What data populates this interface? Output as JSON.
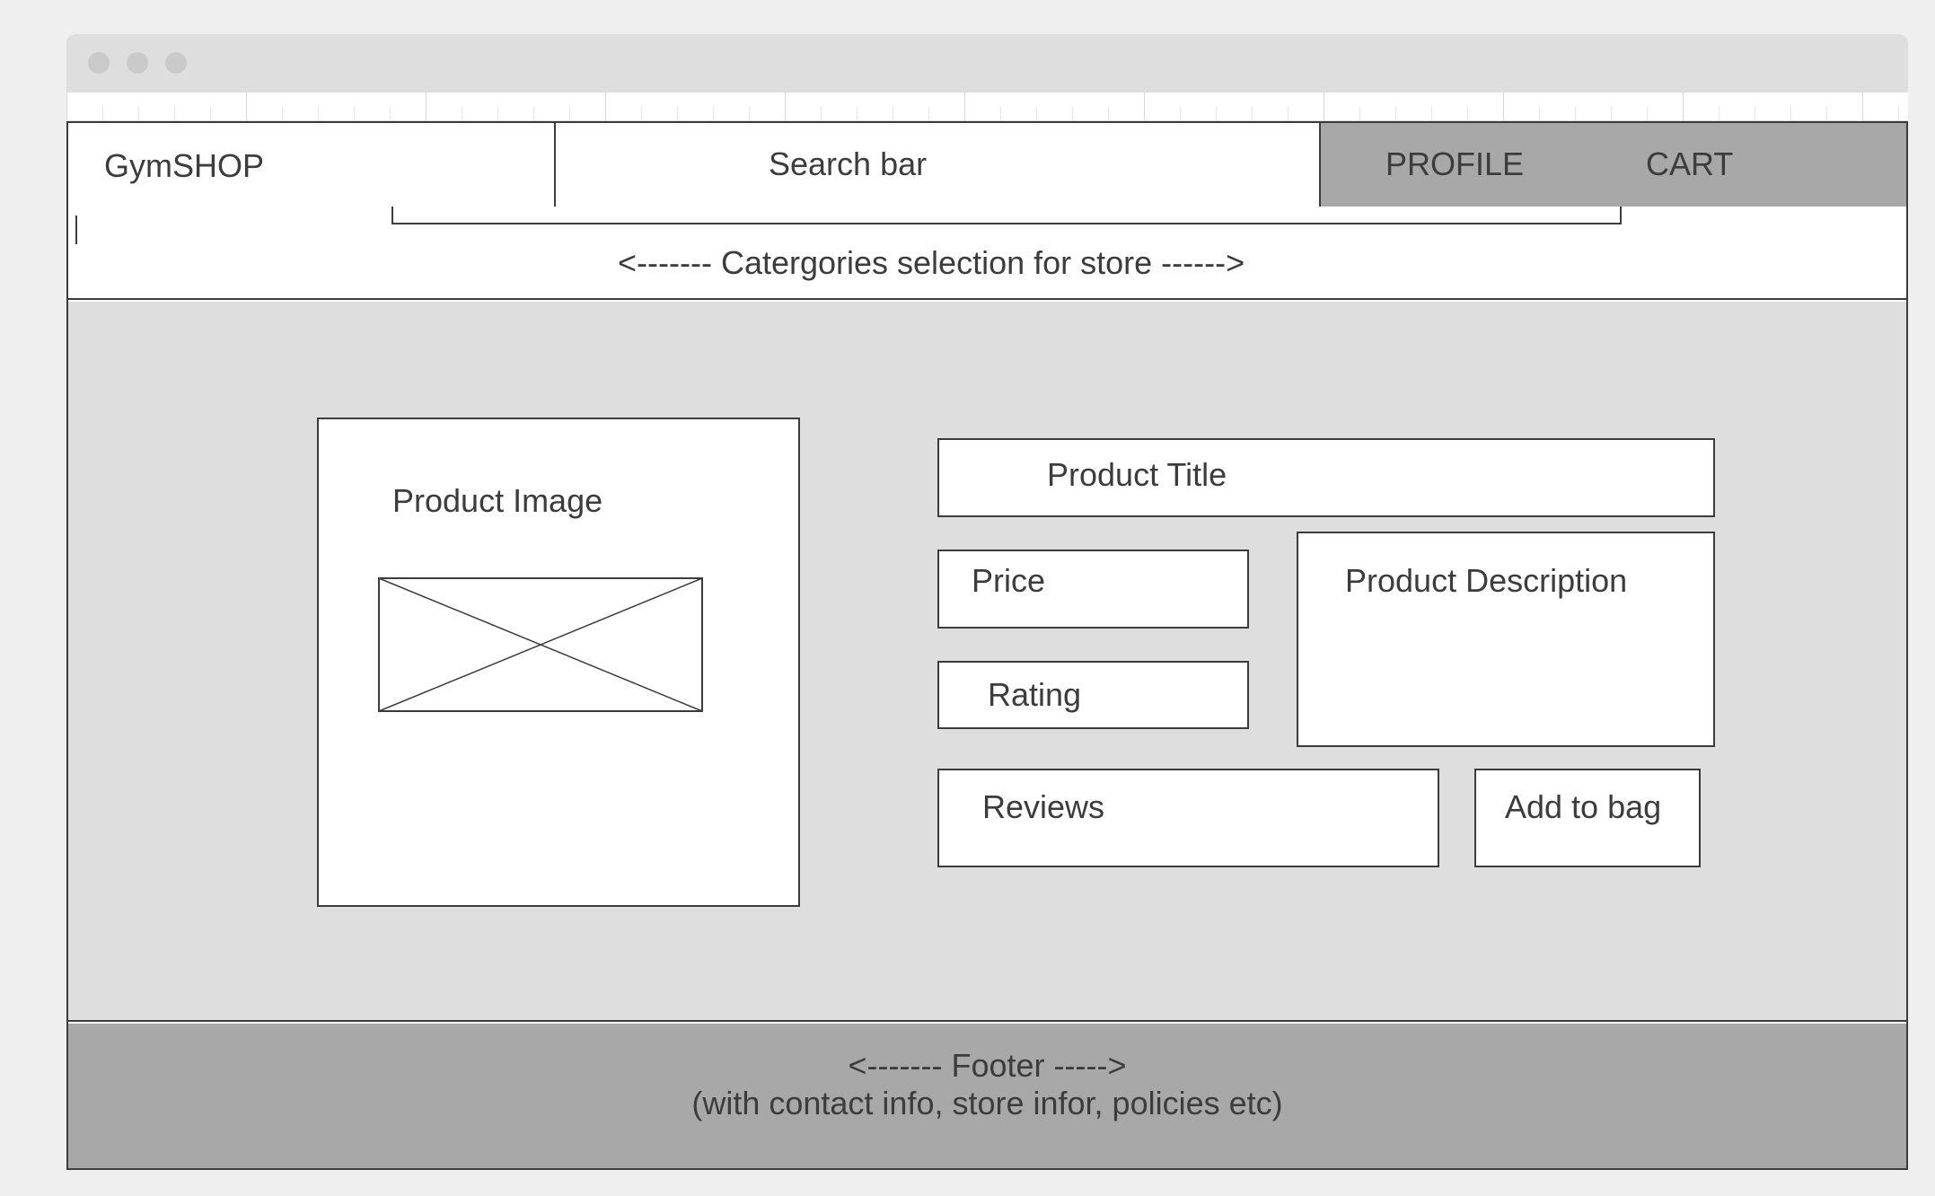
{
  "header": {
    "brand": "GymSHOP",
    "search": "Search bar",
    "nav": {
      "profile": "PROFILE",
      "cart": "CART"
    }
  },
  "categories": {
    "label": "<------- Catergories selection for store ------>"
  },
  "product": {
    "image_label": "Product Image",
    "image_placeholder_icon": "image-placeholder-icon",
    "title": "Product Title",
    "price": "Price",
    "rating": "Rating",
    "description": "Product Description",
    "reviews": "Reviews",
    "add_to_bag": "Add to bag"
  },
  "footer": {
    "line1": "<------- Footer ----->",
    "line2": "(with contact info, store infor, policies etc)"
  },
  "colors": {
    "page_bg": "#efefef",
    "chrome": "#dedede",
    "accent_gray": "#a8a8a8",
    "stroke": "#3c3c3c"
  }
}
